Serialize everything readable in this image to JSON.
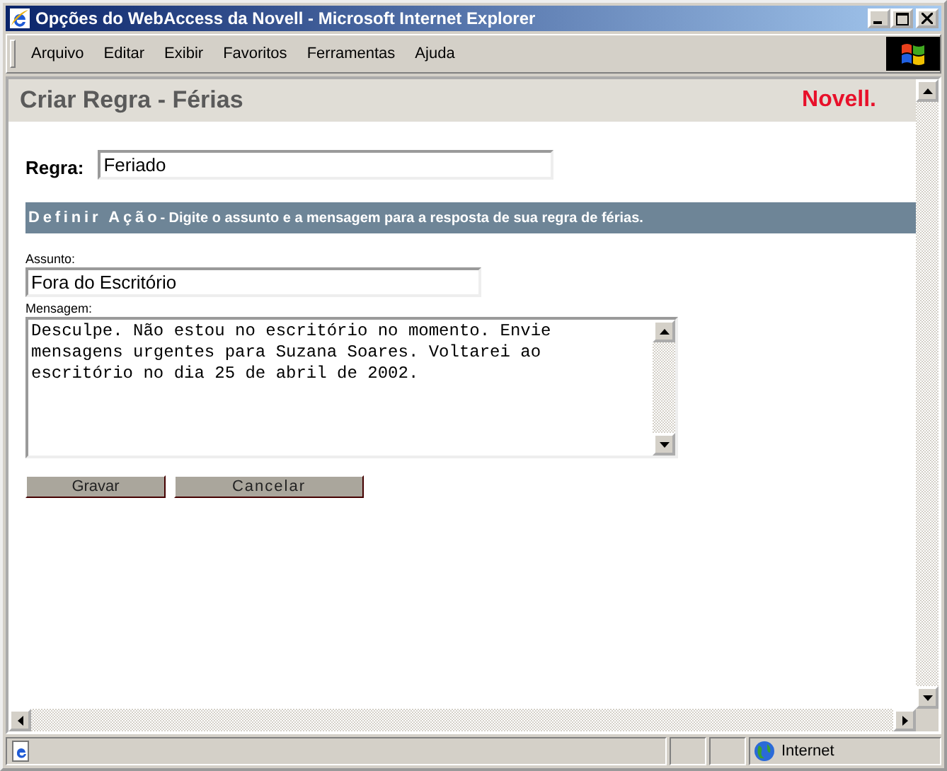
{
  "window": {
    "title": "Opções do WebAccess da Novell - Microsoft Internet Explorer"
  },
  "menu": [
    "Arquivo",
    "Editar",
    "Exibir",
    "Favoritos",
    "Ferramentas",
    "Ajuda"
  ],
  "page": {
    "heading": "Criar Regra - Férias",
    "logo": "Novell."
  },
  "rule": {
    "label": "Regra:",
    "value": "Feriado"
  },
  "section": {
    "title": "Definir Ação",
    "text": "- Digite o assunto e a mensagem para a resposta de sua regra de férias."
  },
  "subject": {
    "label": "Assunto:",
    "value": "Fora do Escritório"
  },
  "message": {
    "label": "Mensagem:",
    "value": "Desculpe. Não estou no escritório no momento. Envie mensagens urgentes para Suzana Soares. Voltarei ao escritório no dia 25 de abril de 2002."
  },
  "buttons": [
    "Gravar",
    "Cancelar"
  ],
  "status_bar": {
    "zone": "Internet"
  }
}
